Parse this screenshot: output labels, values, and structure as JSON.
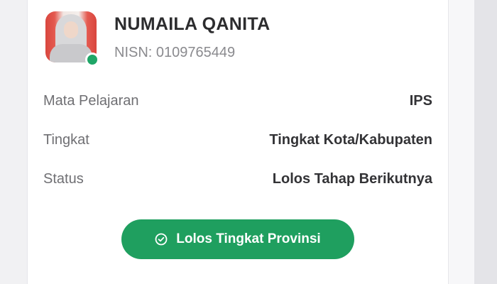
{
  "profile": {
    "name": "NUMAILA QANITA",
    "nisn": "NISN: 0109765449",
    "online_status_color": "#1fa667"
  },
  "details": [
    {
      "label": "Mata Pelajaran",
      "value": "IPS"
    },
    {
      "label": "Tingkat",
      "value": "Tingkat Kota/Kabupaten"
    },
    {
      "label": "Status",
      "value": "Lolos Tahap Berikutnya"
    }
  ],
  "result_button": {
    "label": "Lolos Tingkat Provinsi",
    "icon": "check-circle-icon",
    "color": "#1f9f5f"
  }
}
